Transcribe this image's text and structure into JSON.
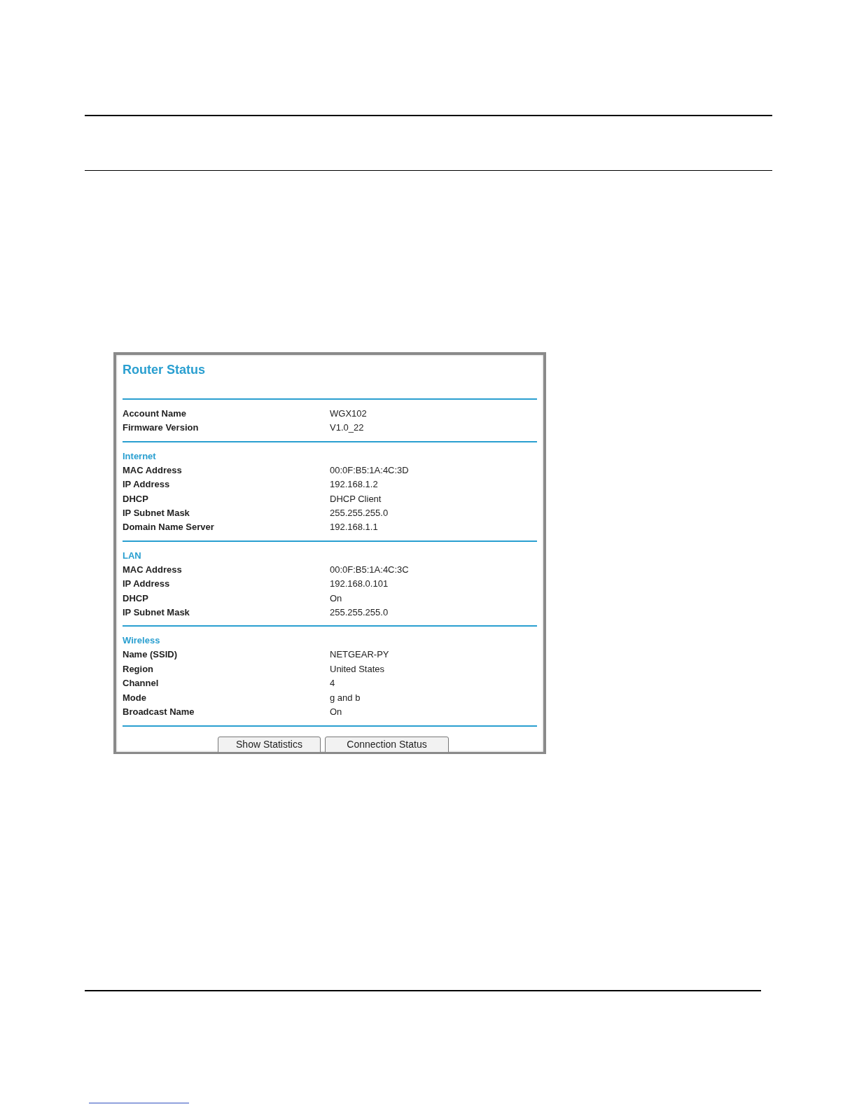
{
  "title": "Router Status",
  "sections": [
    {
      "rows": [
        {
          "label": "Account Name",
          "value": "WGX102"
        },
        {
          "label": "Firmware Version",
          "value": "V1.0_22"
        }
      ]
    },
    {
      "heading": "Internet",
      "rows": [
        {
          "label": "MAC Address",
          "value": "00:0F:B5:1A:4C:3D"
        },
        {
          "label": "IP Address",
          "value": "192.168.1.2"
        },
        {
          "label": "DHCP",
          "value": "DHCP Client"
        },
        {
          "label": "IP Subnet Mask",
          "value": "255.255.255.0"
        },
        {
          "label": "Domain Name Server",
          "value": "192.168.1.1"
        }
      ]
    },
    {
      "heading": "LAN",
      "rows": [
        {
          "label": "MAC Address",
          "value": "00:0F:B5:1A:4C:3C"
        },
        {
          "label": "IP Address",
          "value": "192.168.0.101"
        },
        {
          "label": "DHCP",
          "value": "On"
        },
        {
          "label": "IP Subnet Mask",
          "value": "255.255.255.0"
        }
      ]
    },
    {
      "heading": "Wireless",
      "rows": [
        {
          "label": "Name (SSID)",
          "value": "NETGEAR-PY"
        },
        {
          "label": "Region",
          "value": "United States"
        },
        {
          "label": "Channel",
          "value": "4"
        },
        {
          "label": "Mode",
          "value": "g and b"
        },
        {
          "label": "Broadcast Name",
          "value": "On"
        }
      ]
    }
  ],
  "buttons": [
    "Show Statistics",
    "Connection Status"
  ]
}
